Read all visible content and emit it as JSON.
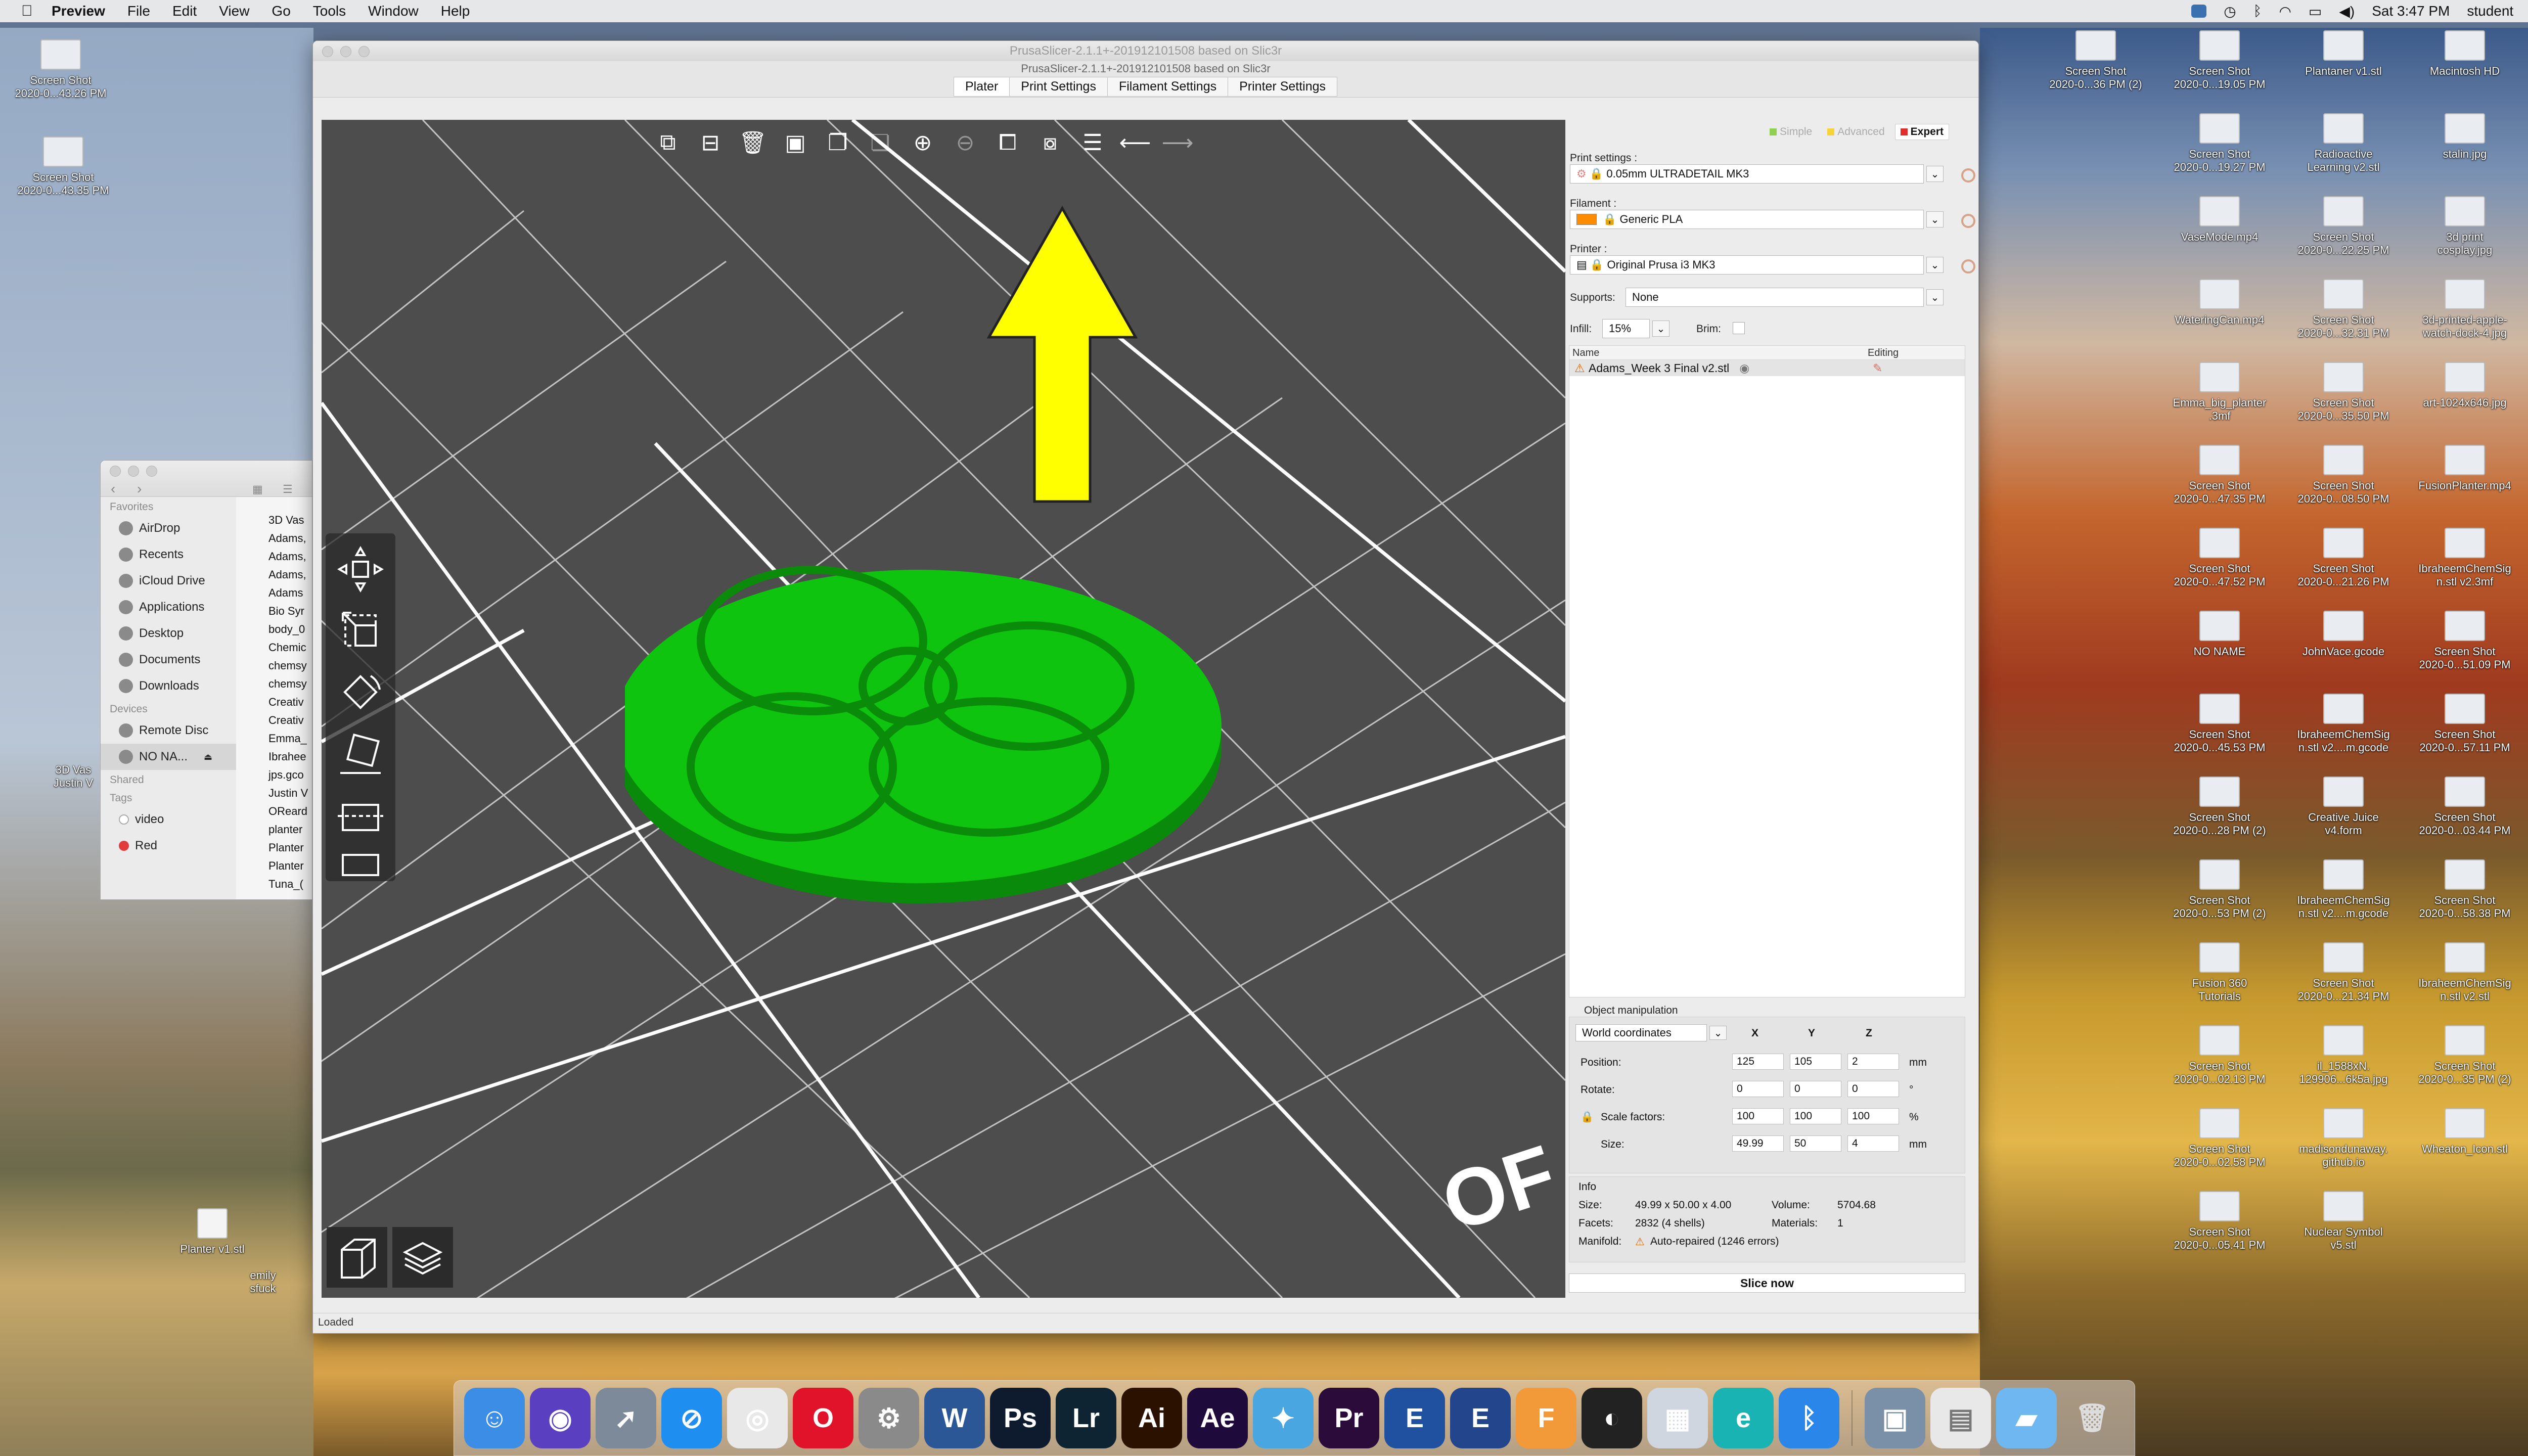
{
  "menubar": {
    "app": "Preview",
    "items": [
      "File",
      "Edit",
      "View",
      "Go",
      "Tools",
      "Window",
      "Help"
    ],
    "datetime": "Sat 3:47 PM",
    "user": "student"
  },
  "desktop_left": [
    {
      "label": "Screen Shot\n2020-0...43.26 PM"
    },
    {
      "label": "Screen Shot\n2020-0...43.35 PM"
    }
  ],
  "desktop_left_lower": {
    "planter": "Planter v1.stl",
    "emily": "emily\nsfuck",
    "justin": "3D Vas\nJustin V"
  },
  "desktop_right": [
    {
      "label": "Screen Shot\n2020-0...36 PM (2)"
    },
    {
      "label": "Screen Shot\n2020-0...19.05 PM"
    },
    {
      "label": "Plantaner v1.stl"
    },
    {
      "label": "Macintosh HD"
    },
    {
      "label": "Screen Shot\n2020-0...19.27 PM"
    },
    {
      "label": "Radioactive\nLearning v2.stl"
    },
    {
      "label": "stalin.jpg"
    },
    {
      "label": "VaseMode.mp4"
    },
    {
      "label": "Screen Shot\n2020-0...22.25 PM"
    },
    {
      "label": "3d print\ncosplay.jpg"
    },
    {
      "label": "WateringCan.mp4"
    },
    {
      "label": "Screen Shot\n2020-0...32.31 PM"
    },
    {
      "label": "3d-printed-apple-\nwatch-dock-4.jpg"
    },
    {
      "label": "Emma_big_planter\n.3mf"
    },
    {
      "label": "Screen Shot\n2020-0...35.50 PM"
    },
    {
      "label": "art-1024x646.jpg"
    },
    {
      "label": "Screen Shot\n2020-0...47.35 PM"
    },
    {
      "label": "Screen Shot\n2020-0...08.50 PM"
    },
    {
      "label": "FusionPlanter.mp4"
    },
    {
      "label": "Screen Shot\n2020-0...47.52 PM"
    },
    {
      "label": "Screen Shot\n2020-0...21.26 PM"
    },
    {
      "label": "IbraheemChemSig\nn.stl v2.3mf"
    },
    {
      "label": "NO NAME"
    },
    {
      "label": "JohnVace.gcode"
    },
    {
      "label": "Screen Shot\n2020-0...51.09 PM"
    },
    {
      "label": "Screen Shot\n2020-0...45.53 PM"
    },
    {
      "label": "IbraheemChemSig\nn.stl v2....m.gcode"
    },
    {
      "label": "Screen Shot\n2020-0...57.11 PM"
    },
    {
      "label": "Screen Shot\n2020-0...28 PM (2)"
    },
    {
      "label": "Creative Juice\nv4.form"
    },
    {
      "label": "Screen Shot\n2020-0...03.44 PM"
    },
    {
      "label": "Screen Shot\n2020-0...53 PM (2)"
    },
    {
      "label": "IbraheemChemSig\nn.stl v2....m.gcode"
    },
    {
      "label": "Screen Shot\n2020-0...58.38 PM"
    },
    {
      "label": "Fusion 360\nTutorials"
    },
    {
      "label": "Screen Shot\n2020-0...21.34 PM"
    },
    {
      "label": "IbraheemChemSig\nn.stl v2.stl"
    },
    {
      "label": "Screen Shot\n2020-0...02.13 PM"
    },
    {
      "label": "il_1588xN.\n129906...6k5a.jpg"
    },
    {
      "label": "Screen Shot\n2020-0...35 PM (2)"
    },
    {
      "label": "Screen Shot\n2020-0...02.58 PM"
    },
    {
      "label": "madisondunaway.\ngithub.io"
    },
    {
      "label": "Wheaton_Icon.stl"
    },
    {
      "label": "Screen Shot\n2020-0...05.41 PM"
    },
    {
      "label": "Nuclear Symbol\nv5.stl"
    }
  ],
  "window": {
    "title": "PrusaSlicer-2.1.1+-201912101508 based on Slic3r",
    "subtitle": "PrusaSlicer-2.1.1+-201912101508 based on Slic3r",
    "tabs": [
      "Plater",
      "Print Settings",
      "Filament Settings",
      "Printer Settings"
    ],
    "status": "Loaded",
    "viewport_text": "OF"
  },
  "panel": {
    "modes": [
      {
        "label": "Simple",
        "color": "#8fd14f"
      },
      {
        "label": "Advanced",
        "color": "#f5d33a"
      },
      {
        "label": "Expert",
        "color": "#e22d2d"
      }
    ],
    "print_settings_label": "Print settings :",
    "print_settings_value": "0.05mm ULTRADETAIL MK3",
    "filament_label": "Filament :",
    "filament_value": "Generic PLA",
    "filament_color": "#ff8c00",
    "printer_label": "Printer :",
    "printer_value": "Original Prusa i3 MK3",
    "supports_label": "Supports:",
    "supports_value": "None",
    "infill_label": "Infill:",
    "infill_value": "15%",
    "brim_label": "Brim:",
    "list_name_header": "Name",
    "list_editing_header": "Editing",
    "object_name": "Adams_Week 3 Final v2.stl",
    "om_title": "Object manipulation",
    "coord_system": "World coordinates",
    "axes": [
      "X",
      "Y",
      "Z"
    ],
    "position_label": "Position:",
    "position": [
      "125",
      "105",
      "2"
    ],
    "position_unit": "mm",
    "rotate_label": "Rotate:",
    "rotate": [
      "0",
      "0",
      "0"
    ],
    "rotate_unit": "°",
    "scale_label": "Scale factors:",
    "scale": [
      "100",
      "100",
      "100"
    ],
    "scale_unit": "%",
    "size_label": "Size:",
    "size": [
      "49.99",
      "50",
      "4"
    ],
    "size_unit": "mm",
    "info_title": "Info",
    "info_size_label": "Size:",
    "info_size_value": "49.99 x 50.00 x 4.00",
    "info_volume_label": "Volume:",
    "info_volume_value": "5704.68",
    "info_facets_label": "Facets:",
    "info_facets_value": "2832 (4 shells)",
    "info_materials_label": "Materials:",
    "info_materials_value": "1",
    "info_manifold_label": "Manifold:",
    "info_manifold_value": "Auto-repaired (1246 errors)",
    "slice_button": "Slice now"
  },
  "finder": {
    "favorites_label": "Favorites",
    "favorites": [
      "AirDrop",
      "Recents",
      "iCloud Drive",
      "Applications",
      "Desktop",
      "Documents",
      "Downloads"
    ],
    "devices_label": "Devices",
    "devices": [
      "Remote Disc",
      "NO NA..."
    ],
    "shared_label": "Shared",
    "tags_label": "Tags",
    "tags": [
      "video",
      "Red"
    ],
    "files": [
      "3D Vas",
      "Adams,",
      "Adams,",
      "Adams,",
      "Adams",
      "Bio Syr",
      "body_0",
      "Chemic",
      "chemsy",
      "chemsy",
      "Creativ",
      "Creativ",
      "Emma_",
      "Ibrahee",
      "jps.gco",
      "Justin V",
      "OReard",
      "planter",
      "Planter",
      "Planter",
      "Tuna_("
    ]
  },
  "dock": {
    "apps": [
      {
        "name": "finder",
        "color": "#3b8de6",
        "glyph": "☺"
      },
      {
        "name": "siri",
        "color": "#5a3fc0",
        "glyph": "◉"
      },
      {
        "name": "launchpad",
        "color": "#7d8a99",
        "glyph": "➚"
      },
      {
        "name": "safari",
        "color": "#1e8ef0",
        "glyph": "⊘"
      },
      {
        "name": "chrome",
        "color": "#e8e8e8",
        "glyph": "◎"
      },
      {
        "name": "opera",
        "color": "#e0132b",
        "glyph": "O"
      },
      {
        "name": "system-preferences",
        "color": "#8a8a8a",
        "glyph": "⚙"
      },
      {
        "name": "word",
        "color": "#2b5797",
        "glyph": "W"
      },
      {
        "name": "photoshop",
        "color": "#0e1a2e",
        "glyph": "Ps"
      },
      {
        "name": "lightroom",
        "color": "#0f2433",
        "glyph": "Lr"
      },
      {
        "name": "illustrator",
        "color": "#2b1200",
        "glyph": "Ai"
      },
      {
        "name": "after-effects",
        "color": "#1f0b3b",
        "glyph": "Ae"
      },
      {
        "name": "butterfly-app",
        "color": "#4aa6e0",
        "glyph": "✦"
      },
      {
        "name": "premiere",
        "color": "#2a0b3a",
        "glyph": "Pr"
      },
      {
        "name": "e-app",
        "color": "#2050a0",
        "glyph": "E"
      },
      {
        "name": "e-app-2",
        "color": "#23458c",
        "glyph": "E"
      },
      {
        "name": "fusion-360",
        "color": "#f29a3a",
        "glyph": "F"
      },
      {
        "name": "prusaslicer",
        "color": "#222",
        "glyph": "◐"
      },
      {
        "name": "preview",
        "color": "#cfd6e0",
        "glyph": "▦"
      },
      {
        "name": "e-learning",
        "color": "#1ab3b3",
        "glyph": "e"
      },
      {
        "name": "bluetooth",
        "color": "#2a86e8",
        "glyph": "ᛒ"
      },
      {
        "name": "image-capture",
        "color": "#7a8fa8",
        "glyph": "▣"
      }
    ]
  }
}
